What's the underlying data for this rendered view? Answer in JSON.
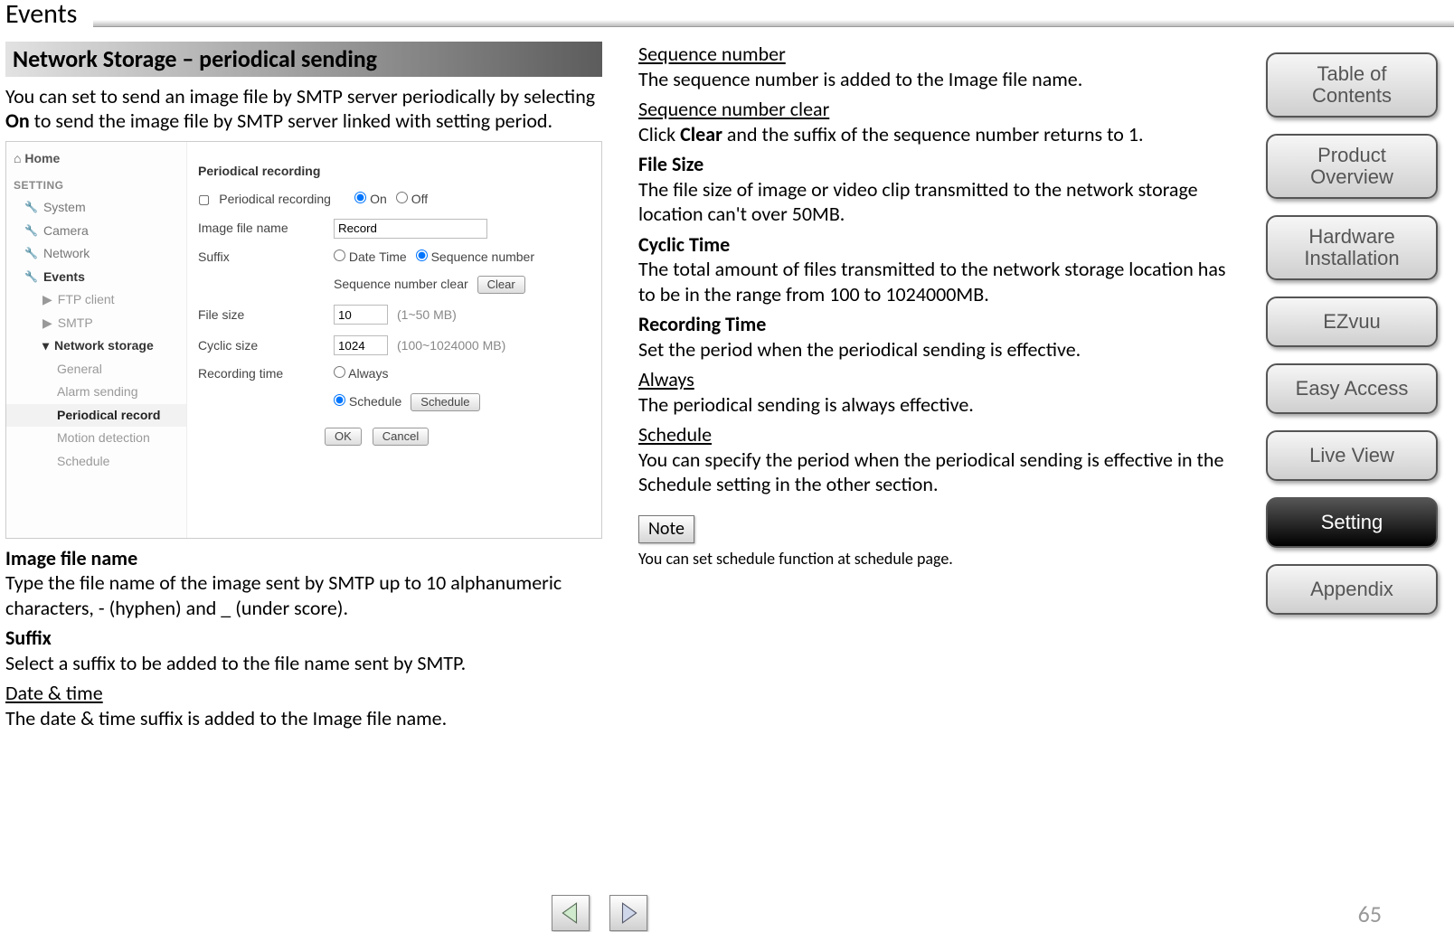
{
  "title": "Events",
  "section_header": "Network Storage – periodical sending",
  "intro_pre": "You can set to send an image file by SMTP server periodically by selecting ",
  "intro_bold": "On",
  "intro_post": " to send the image file by SMTP server linked with setting period.",
  "shot": {
    "home": "Home",
    "setting_label": "SETTING",
    "tree": [
      "System",
      "Camera",
      "Network",
      "Events"
    ],
    "events_children": [
      "FTP client",
      "SMTP",
      "Network storage"
    ],
    "ns_children": [
      "General",
      "Alarm sending",
      "Periodical record",
      "Motion detection",
      "Schedule"
    ],
    "form_title": "Periodical recording",
    "periodical_recording": "Periodical recording",
    "on": "On",
    "off": "Off",
    "image_file_name": "Image file name",
    "image_file_value": "Record",
    "suffix": "Suffix",
    "date_time": "Date Time",
    "seq_number": "Sequence number",
    "seq_clear_lbl": "Sequence number clear",
    "clear_btn": "Clear",
    "file_size": "File size",
    "file_size_val": "10",
    "file_size_hint": "(1~50 MB)",
    "cyclic_size": "Cyclic size",
    "cyclic_val": "1024",
    "cyclic_hint": "(100~1024000 MB)",
    "rec_time": "Recording time",
    "always": "Always",
    "schedule": "Schedule",
    "schedule_btn": "Schedule",
    "ok": "OK",
    "cancel": "Cancel"
  },
  "left_blocks": {
    "image_file_name_h": "Image file name",
    "image_file_name_p": "Type the file name of the image sent by SMTP up to 10 alphanumeric characters, - (hyphen) and _ (under score).",
    "suffix_h": "Suffix",
    "suffix_p": "Select a suffix to be added to the file name sent by SMTP.",
    "date_time_h": "Date & time",
    "date_time_p": "The date & time suffix is added to the Image file name."
  },
  "right_blocks": {
    "seq_h": "Sequence number",
    "seq_p": "The sequence number is added to the Image file name.",
    "seqc_h": "Sequence number clear",
    "seqc_pre": "Click ",
    "seqc_bold": "Clear",
    "seqc_post": " and the suffix of the sequence number returns to 1.",
    "fsize_h": "File Size",
    "fsize_p": "The file size of image or video clip transmitted to the network storage location can't over 50MB.",
    "cyc_h": "Cyclic Time",
    "cyc_p": "The total amount of files transmitted to the network storage location has to be in the range from 100 to 1024000MB.",
    "rec_h": "Recording Time",
    "rec_p": "Set the period when the periodical sending is effective.",
    "always_h": "Always",
    "always_p": "The periodical sending is always effective.",
    "sched_h": "Schedule",
    "sched_p": "You can specify the period when the periodical sending is effective in the Schedule setting in the other section.",
    "note_label": "Note",
    "note_text": "You can set schedule function at schedule page."
  },
  "nav": [
    "Table of Contents",
    "Product Overview",
    "Hardware Installation",
    "EZvuu",
    "Easy Access",
    "Live View",
    "Setting",
    "Appendix"
  ],
  "nav_active_index": 6,
  "page_number": "65"
}
